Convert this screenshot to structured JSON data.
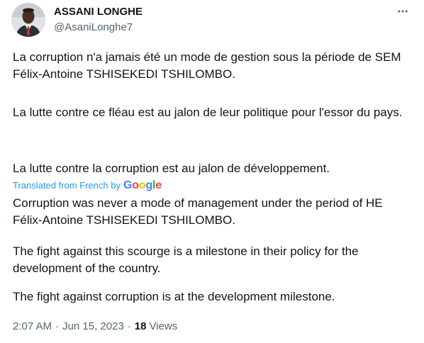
{
  "author": {
    "display_name": "ASSANI LONGHE",
    "handle": "@AsaniLonghe7"
  },
  "icons": {
    "more": "more-horizontal-icon",
    "avatar": "profile-photo"
  },
  "original": {
    "paragraphs": [
      "La corruption n'a jamais été un mode de gestion sous la période de SEM Félix-Antoine TSHISEKEDI TSHILOMBO.",
      "La lutte contre ce fléau est au jalon de leur politique pour l'essor du pays.",
      "La lutte contre la corruption est au jalon de développement."
    ]
  },
  "translation": {
    "label": "Translated from French by",
    "provider": "Google",
    "paragraphs": [
      "Corruption was never a mode of management under the period of HE Félix-Antoine TSHISEKEDI TSHILOMBO.",
      "The fight against this scourge is a milestone in their policy for the development of the country.",
      "The fight against corruption is at the development milestone."
    ]
  },
  "meta": {
    "time": "2:07 AM",
    "separator": "·",
    "date": "Jun 15, 2023",
    "views_count": "18",
    "views_label": "Views"
  },
  "colors": {
    "text": "#0f1419",
    "secondary": "#536471",
    "link": "#1d9bf0"
  }
}
